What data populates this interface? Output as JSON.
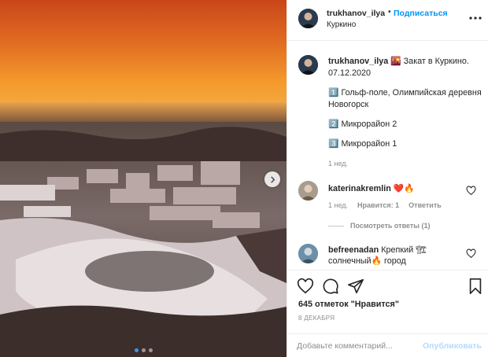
{
  "post": {
    "photo": {
      "alt": "Sunset over snowy Kurkino residential area, aerial view",
      "slide_dots": 3,
      "active_dot": 1
    },
    "header": {
      "username": "trukhanov_ilya",
      "separator": "•",
      "follow_label": "Подписаться",
      "location": "Куркино",
      "more_icon": "more-horizontal-icon"
    },
    "caption": {
      "username": "trukhanov_ilya",
      "line1": "🌇 Закат в Куркино. 07.12.2020",
      "item1": "1️⃣ Гольф-поле, Олимпийская деревня Новогорск",
      "item2": "2️⃣ Микрорайон 2",
      "item3": "3️⃣ Микрорайон 1",
      "time": "1 нед."
    },
    "comments": [
      {
        "username": "katerinakremlin",
        "text": "❤️🔥",
        "time": "1 нед.",
        "likes": "Нравится: 1",
        "reply_label": "Ответить",
        "view_replies": "Посмотреть ответы (1)"
      },
      {
        "username": "befreenadan",
        "text": "Крепкий 🏗 солнечный🔥 город"
      }
    ],
    "actions": {
      "likes_text": "645 отметок \"Нравится\"",
      "date": "8 ДЕКАБРЯ"
    },
    "add_comment": {
      "placeholder": "Добавьте комментарий...",
      "publish_label": "Опубликовать"
    }
  }
}
